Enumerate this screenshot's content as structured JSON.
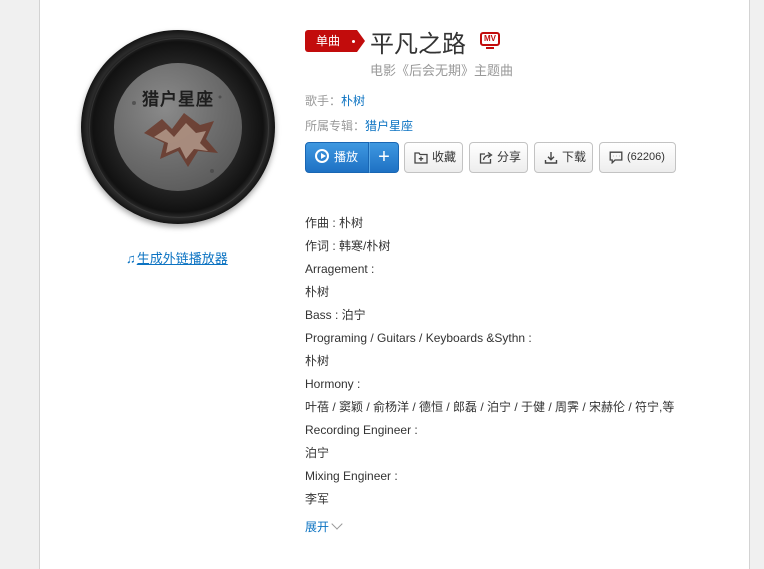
{
  "album": {
    "cover_text": "猎户星座",
    "ext_player_label": "生成外链播放器"
  },
  "song": {
    "badge": "单曲",
    "title": "平凡之路",
    "mv_label": "MV",
    "subtitle": "电影《后会无期》主题曲",
    "singer_label": "歌手：",
    "singer": "朴树",
    "album_label": "所属专辑：",
    "album": "猎户星座"
  },
  "actions": {
    "play": "播放",
    "add": "+",
    "collect": "收藏",
    "share": "分享",
    "download": "下载",
    "comments": "(62206)"
  },
  "credits": [
    "作曲 : 朴树",
    "作词 : 韩寒/朴树",
    "Arragement :",
    "朴树",
    "Bass : 泊宁",
    "Programing / Guitars / Keyboards &Sythn :",
    "朴树",
    "Hormony :",
    "叶蓓 / 窦颖 / 俞杨洋 / 德恒 / 郎磊 / 泊宁 / 于健 / 周霁 / 宋赫伦 / 符宁,等",
    "Recording Engineer :",
    "泊宁",
    "Mixing Engineer :",
    "李军"
  ],
  "expand_label": "展开",
  "colors": {
    "brand_red": "#c20c0c",
    "link_blue": "#0c73c2",
    "play_blue": "#2a80cf"
  }
}
